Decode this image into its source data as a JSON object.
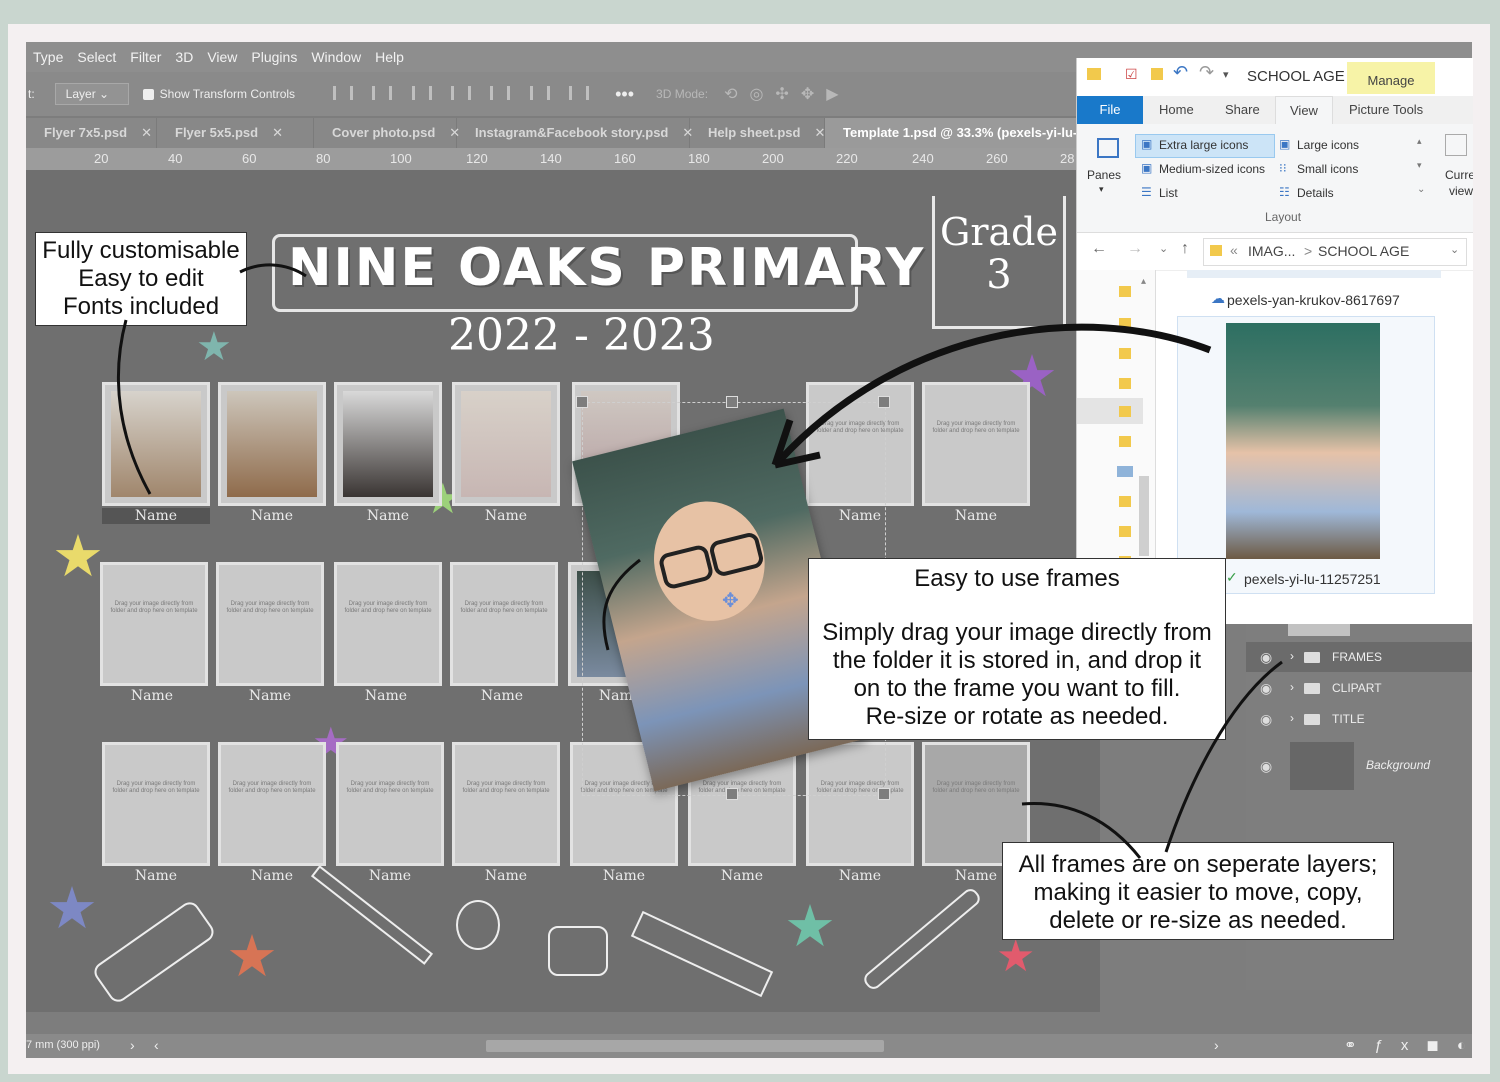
{
  "menu": [
    "Type",
    "Select",
    "Filter",
    "3D",
    "View",
    "Plugins",
    "Window",
    "Help"
  ],
  "options": {
    "prefix": "t:",
    "layer_select": "Layer",
    "transform_label": "Show Transform Controls",
    "threed_mode": "3D Mode:"
  },
  "tabs": [
    {
      "label": "Flyer 7x5.psd"
    },
    {
      "label": "Flyer 5x5.psd"
    },
    {
      "label": "Cover photo.psd"
    },
    {
      "label": "Instagram&Facebook story.psd"
    },
    {
      "label": "Help sheet.psd"
    },
    {
      "label": "Template 1.psd @ 33.3% (pexels-yi-lu-112"
    }
  ],
  "ruler": [
    "20",
    "40",
    "60",
    "80",
    "100",
    "120",
    "140",
    "160",
    "180",
    "200",
    "220",
    "240",
    "260",
    "28"
  ],
  "poster": {
    "title": "NINE OAKS PRIMARY",
    "years": "2022 - 2023",
    "grade_word": "Grade",
    "grade_num": "3",
    "name_label": "Name",
    "drop_hint": "Drag your image directly from folder and drop here on template"
  },
  "callouts": {
    "left": [
      "Fully customisable",
      "Easy to edit",
      "Fonts included"
    ],
    "middle_title": "Easy to use frames",
    "middle_body": [
      "Simply drag your image directly from",
      "the folder it is stored in, and drop it",
      "on to the frame you want to fill.",
      "Re-size or rotate as needed."
    ],
    "bottom": [
      "All frames are on seperate layers;",
      "making it easier to move, copy,",
      "delete or re-size as needed."
    ]
  },
  "explorer": {
    "title": "SCHOOL AGE",
    "manage": "Manage",
    "tabs": {
      "file": "File",
      "home": "Home",
      "share": "Share",
      "view": "View",
      "picture_tools": "Picture Tools"
    },
    "layout_options": [
      "Extra large icons",
      "Large icons",
      "Medium-sized icons",
      "Small icons",
      "List",
      "Details"
    ],
    "panes": "Panes",
    "layout_group": "Layout",
    "current_view": [
      "Curre",
      "view"
    ],
    "breadcrumb": {
      "part1": "IMAG...",
      "sep": ">",
      "part2": "SCHOOL AGE"
    },
    "file_top": "pexels-yan-krukov-8617697",
    "file_selected": "pexels-yi-lu-11257251"
  },
  "layers": [
    {
      "name": "FRAMES"
    },
    {
      "name": "CLIPART"
    },
    {
      "name": "TITLE"
    },
    {
      "name": "Background"
    }
  ],
  "status": {
    "text": "7 mm (300 ppi)"
  },
  "colors": {
    "ps_gray": "#7d7d7d",
    "explorer_blue": "#1979ca",
    "manage_yellow": "#f7f3a7"
  }
}
